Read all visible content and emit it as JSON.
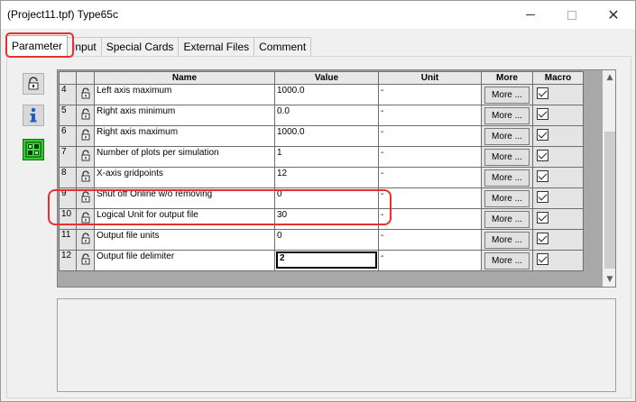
{
  "window": {
    "title": "(Project11.tpf) Type65c"
  },
  "tabs": [
    {
      "label": "Parameter"
    },
    {
      "label": "Input"
    },
    {
      "label": "Special Cards"
    },
    {
      "label": "External Files"
    },
    {
      "label": "Comment"
    }
  ],
  "grid": {
    "headers": {
      "name": "Name",
      "value": "Value",
      "unit": "Unit",
      "more": "More",
      "macro": "Macro"
    },
    "rows": [
      {
        "num": "4",
        "name": "Left axis maximum",
        "value": "1000.0",
        "unit": "-",
        "more": "More ...",
        "macro_checked": true
      },
      {
        "num": "5",
        "name": "Right axis minimum",
        "value": "0.0",
        "unit": "-",
        "more": "More ...",
        "macro_checked": true
      },
      {
        "num": "6",
        "name": "Right axis maximum",
        "value": "1000.0",
        "unit": "-",
        "more": "More ...",
        "macro_checked": true
      },
      {
        "num": "7",
        "name": "Number of plots per simulation",
        "value": "1",
        "unit": "-",
        "more": "More ...",
        "macro_checked": true
      },
      {
        "num": "8",
        "name": "X-axis gridpoints",
        "value": "12",
        "unit": "-",
        "more": "More ...",
        "macro_checked": true
      },
      {
        "num": "9",
        "name": "Shut off Online w/o removing",
        "value": "0",
        "unit": "-",
        "more": "More ...",
        "macro_checked": true
      },
      {
        "num": "10",
        "name": "Logical Unit for output file",
        "value": "30",
        "unit": "-",
        "more": "More ...",
        "macro_checked": true
      },
      {
        "num": "11",
        "name": "Output file units",
        "value": "0",
        "unit": "-",
        "more": "More ...",
        "macro_checked": true
      },
      {
        "num": "12",
        "name": "Output file delimiter",
        "value": "2",
        "unit": "-",
        "more": "More ...",
        "macro_checked": true
      }
    ]
  },
  "icons": {
    "sidebar": [
      "lock-icon",
      "info-icon",
      "grid-icon"
    ],
    "row_lock": "lock-icon"
  },
  "colors": {
    "highlight": "#e8312f",
    "info_icon": "#1b5fc4",
    "grid_icon_bg": "#2ecc2e"
  }
}
